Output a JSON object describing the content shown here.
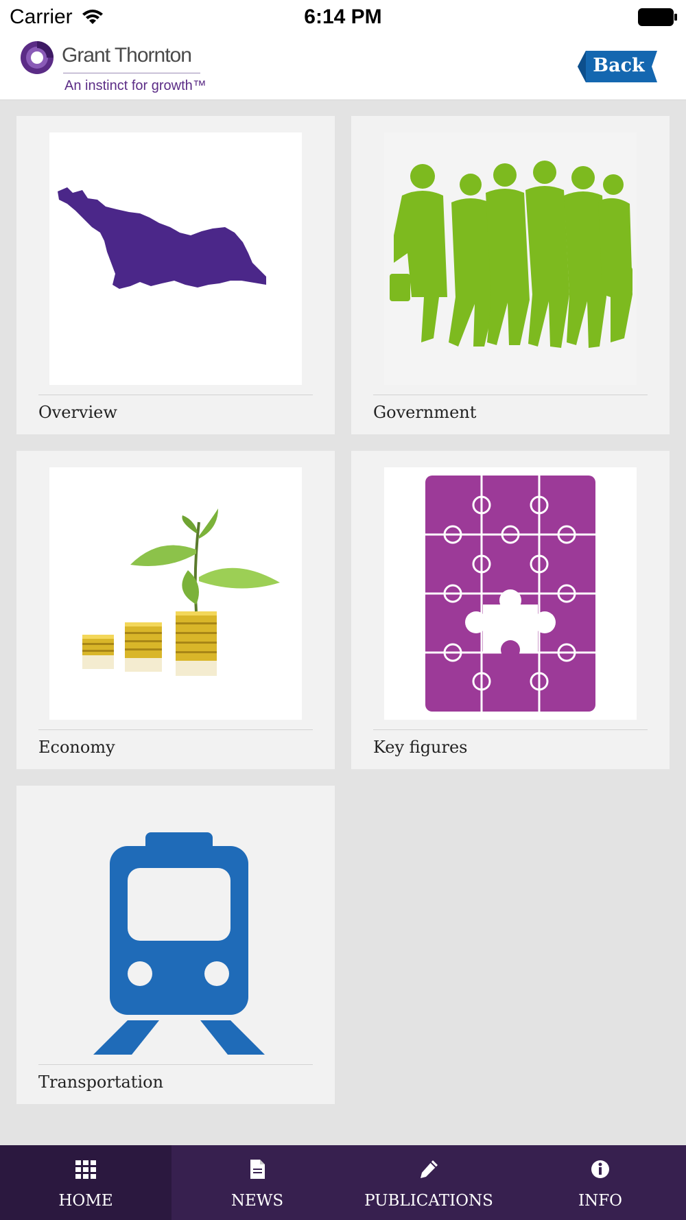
{
  "status_bar": {
    "carrier": "Carrier",
    "time": "6:14 PM"
  },
  "header": {
    "logo_name": "Grant Thornton",
    "logo_tagline": "An instinct for growth™",
    "back_label": "Back"
  },
  "tiles": [
    {
      "label": "Overview",
      "image": "georgia-map-image"
    },
    {
      "label": "Government",
      "image": "people-silhouette-image"
    },
    {
      "label": "Economy",
      "image": "plant-coins-image"
    },
    {
      "label": "Key figures",
      "image": "puzzle-image"
    },
    {
      "label": "Transportation",
      "image": "train-icon"
    }
  ],
  "tabbar": {
    "items": [
      {
        "label": "HOME",
        "icon": "grid-icon",
        "active": true
      },
      {
        "label": "NEWS",
        "icon": "document-icon",
        "active": false
      },
      {
        "label": "PUBLICATIONS",
        "icon": "pencil-icon",
        "active": false
      },
      {
        "label": "INFO",
        "icon": "info-icon",
        "active": false
      }
    ]
  },
  "colors": {
    "brand_purple": "#5b2c86",
    "tabbar_bg": "#37204f",
    "back_blue": "#1467b0",
    "map_purple": "#4b2789",
    "people_green": "#7dba1f",
    "puzzle_magenta": "#9c3a98",
    "train_blue": "#1f6bb8"
  }
}
